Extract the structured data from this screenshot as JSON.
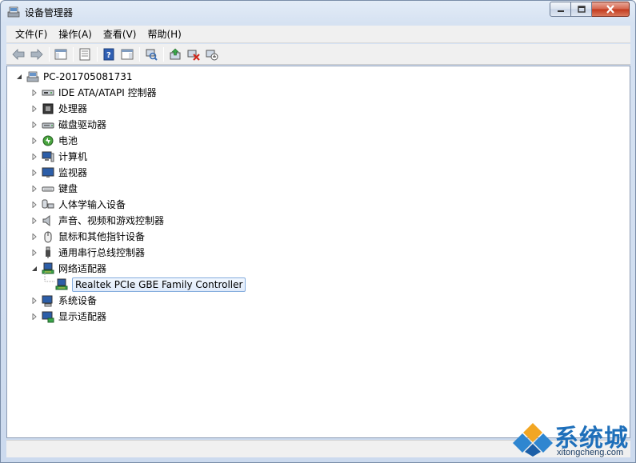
{
  "window": {
    "title": "设备管理器"
  },
  "menubar": {
    "items": [
      {
        "label": "文件(F)"
      },
      {
        "label": "操作(A)"
      },
      {
        "label": "查看(V)"
      },
      {
        "label": "帮助(H)"
      }
    ]
  },
  "toolbar": {
    "buttons": [
      {
        "icon": "back-arrow-icon"
      },
      {
        "icon": "forward-arrow-icon"
      },
      {
        "icon": "show-hide-console-tree-icon"
      },
      {
        "icon": "properties-icon"
      },
      {
        "icon": "help-icon"
      },
      {
        "icon": "show-hide-action-pane-icon"
      },
      {
        "icon": "scan-hardware-changes-icon"
      },
      {
        "icon": "update-driver-icon"
      },
      {
        "icon": "uninstall-device-icon"
      },
      {
        "icon": "disable-device-icon"
      }
    ]
  },
  "tree": {
    "root": {
      "label": "PC-201705081731",
      "expanded": true,
      "icon": "computer-root-icon"
    },
    "items": [
      {
        "label": "IDE ATA/ATAPI 控制器",
        "icon": "ide-controller-icon",
        "expanded": false
      },
      {
        "label": "处理器",
        "icon": "processor-icon",
        "expanded": false
      },
      {
        "label": "磁盘驱动器",
        "icon": "disk-drive-icon",
        "expanded": false
      },
      {
        "label": "电池",
        "icon": "battery-icon",
        "expanded": false
      },
      {
        "label": "计算机",
        "icon": "computer-icon",
        "expanded": false
      },
      {
        "label": "监视器",
        "icon": "monitor-icon",
        "expanded": false
      },
      {
        "label": "键盘",
        "icon": "keyboard-icon",
        "expanded": false
      },
      {
        "label": "人体学输入设备",
        "icon": "hid-icon",
        "expanded": false
      },
      {
        "label": "声音、视频和游戏控制器",
        "icon": "speaker-icon",
        "expanded": false
      },
      {
        "label": "鼠标和其他指针设备",
        "icon": "mouse-icon",
        "expanded": false
      },
      {
        "label": "通用串行总线控制器",
        "icon": "usb-icon",
        "expanded": false
      },
      {
        "label": "网络适配器",
        "icon": "network-adapter-icon",
        "expanded": true,
        "children": [
          {
            "label": "Realtek PCIe GBE Family Controller",
            "icon": "network-card-icon",
            "selected": true
          }
        ]
      },
      {
        "label": "系统设备",
        "icon": "system-device-icon",
        "expanded": false
      },
      {
        "label": "显示适配器",
        "icon": "display-adapter-icon",
        "expanded": false
      }
    ]
  },
  "watermark": {
    "brand": "系统城",
    "url": "xitongcheng.com"
  },
  "colors": {
    "selection_border": "#84acdd",
    "watermark_blue": "#1e6fba",
    "close_red": "#c2381c"
  }
}
